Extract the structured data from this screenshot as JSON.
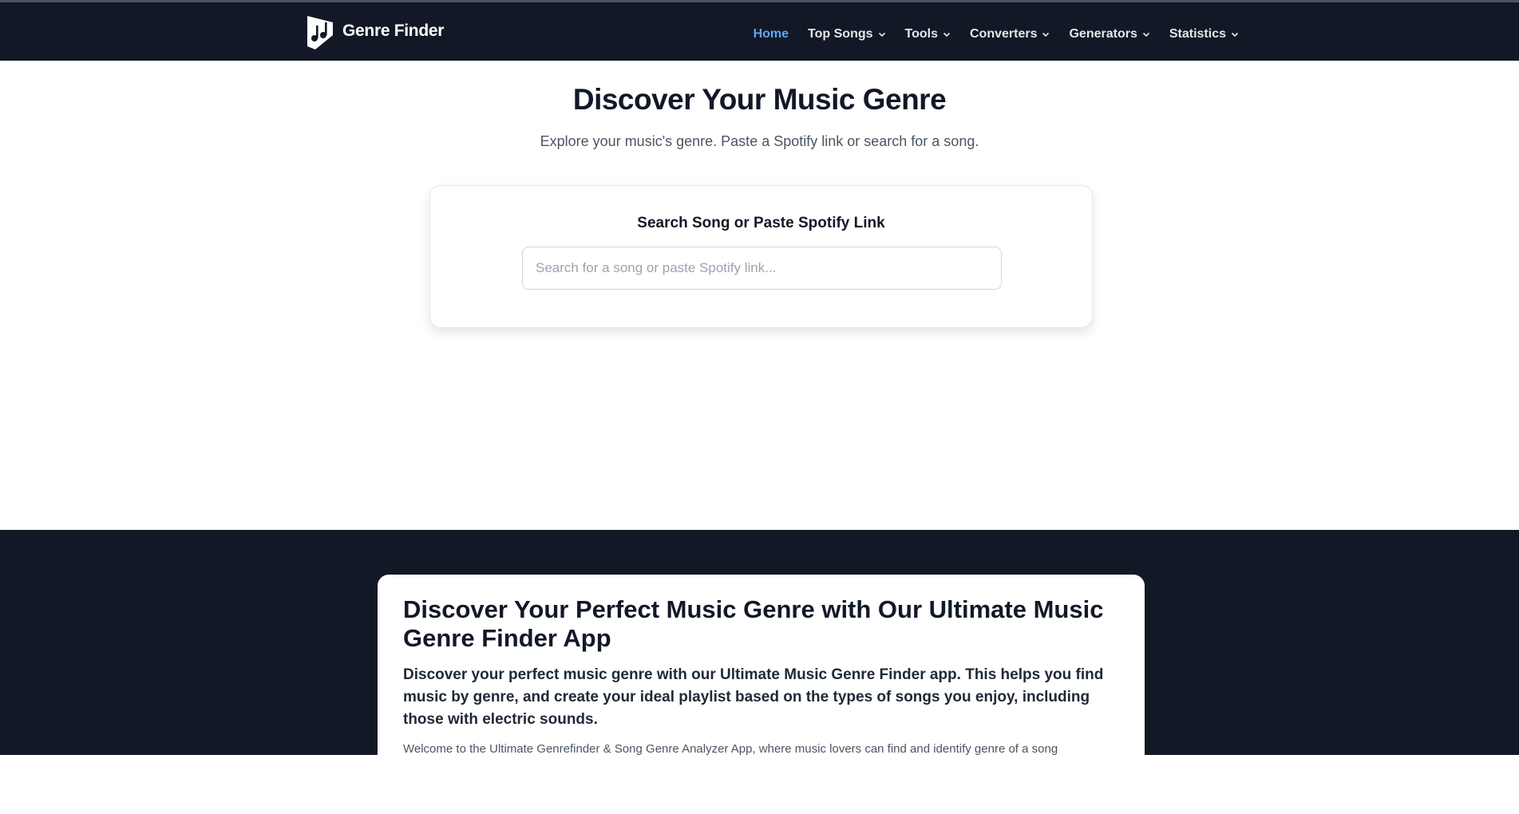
{
  "brand": {
    "name": "Genre Finder",
    "icon": "music-note-logo-icon"
  },
  "nav": {
    "items": [
      {
        "label": "Home",
        "active": true,
        "dropdown": false
      },
      {
        "label": "Top Songs",
        "active": false,
        "dropdown": true
      },
      {
        "label": "Tools",
        "active": false,
        "dropdown": true
      },
      {
        "label": "Converters",
        "active": false,
        "dropdown": true
      },
      {
        "label": "Generators",
        "active": false,
        "dropdown": true
      },
      {
        "label": "Statistics",
        "active": false,
        "dropdown": true
      }
    ],
    "dropdown_icon": "chevron-down-icon"
  },
  "hero": {
    "title": "Discover Your Music Genre",
    "subtitle": "Explore your music's genre. Paste a Spotify link or search for a song."
  },
  "search": {
    "label": "Search Song or Paste Spotify Link",
    "placeholder": "Search for a song or paste Spotify link...",
    "value": ""
  },
  "article": {
    "title": "Discover Your Perfect Music Genre with Our Ultimate Music Genre Finder App",
    "lead": "Discover your perfect music genre with our Ultimate Music Genre Finder app. This helps you find music by genre, and create your ideal playlist based on the types of songs you enjoy, including those with electric sounds.",
    "body": "Welcome to the Ultimate Genrefinder & Song Genre Analyzer App, where music lovers can find and identify genre of a song"
  },
  "colors": {
    "navbar_bg": "#121826",
    "accent_active": "#60a5fa",
    "title_text": "#111827"
  }
}
